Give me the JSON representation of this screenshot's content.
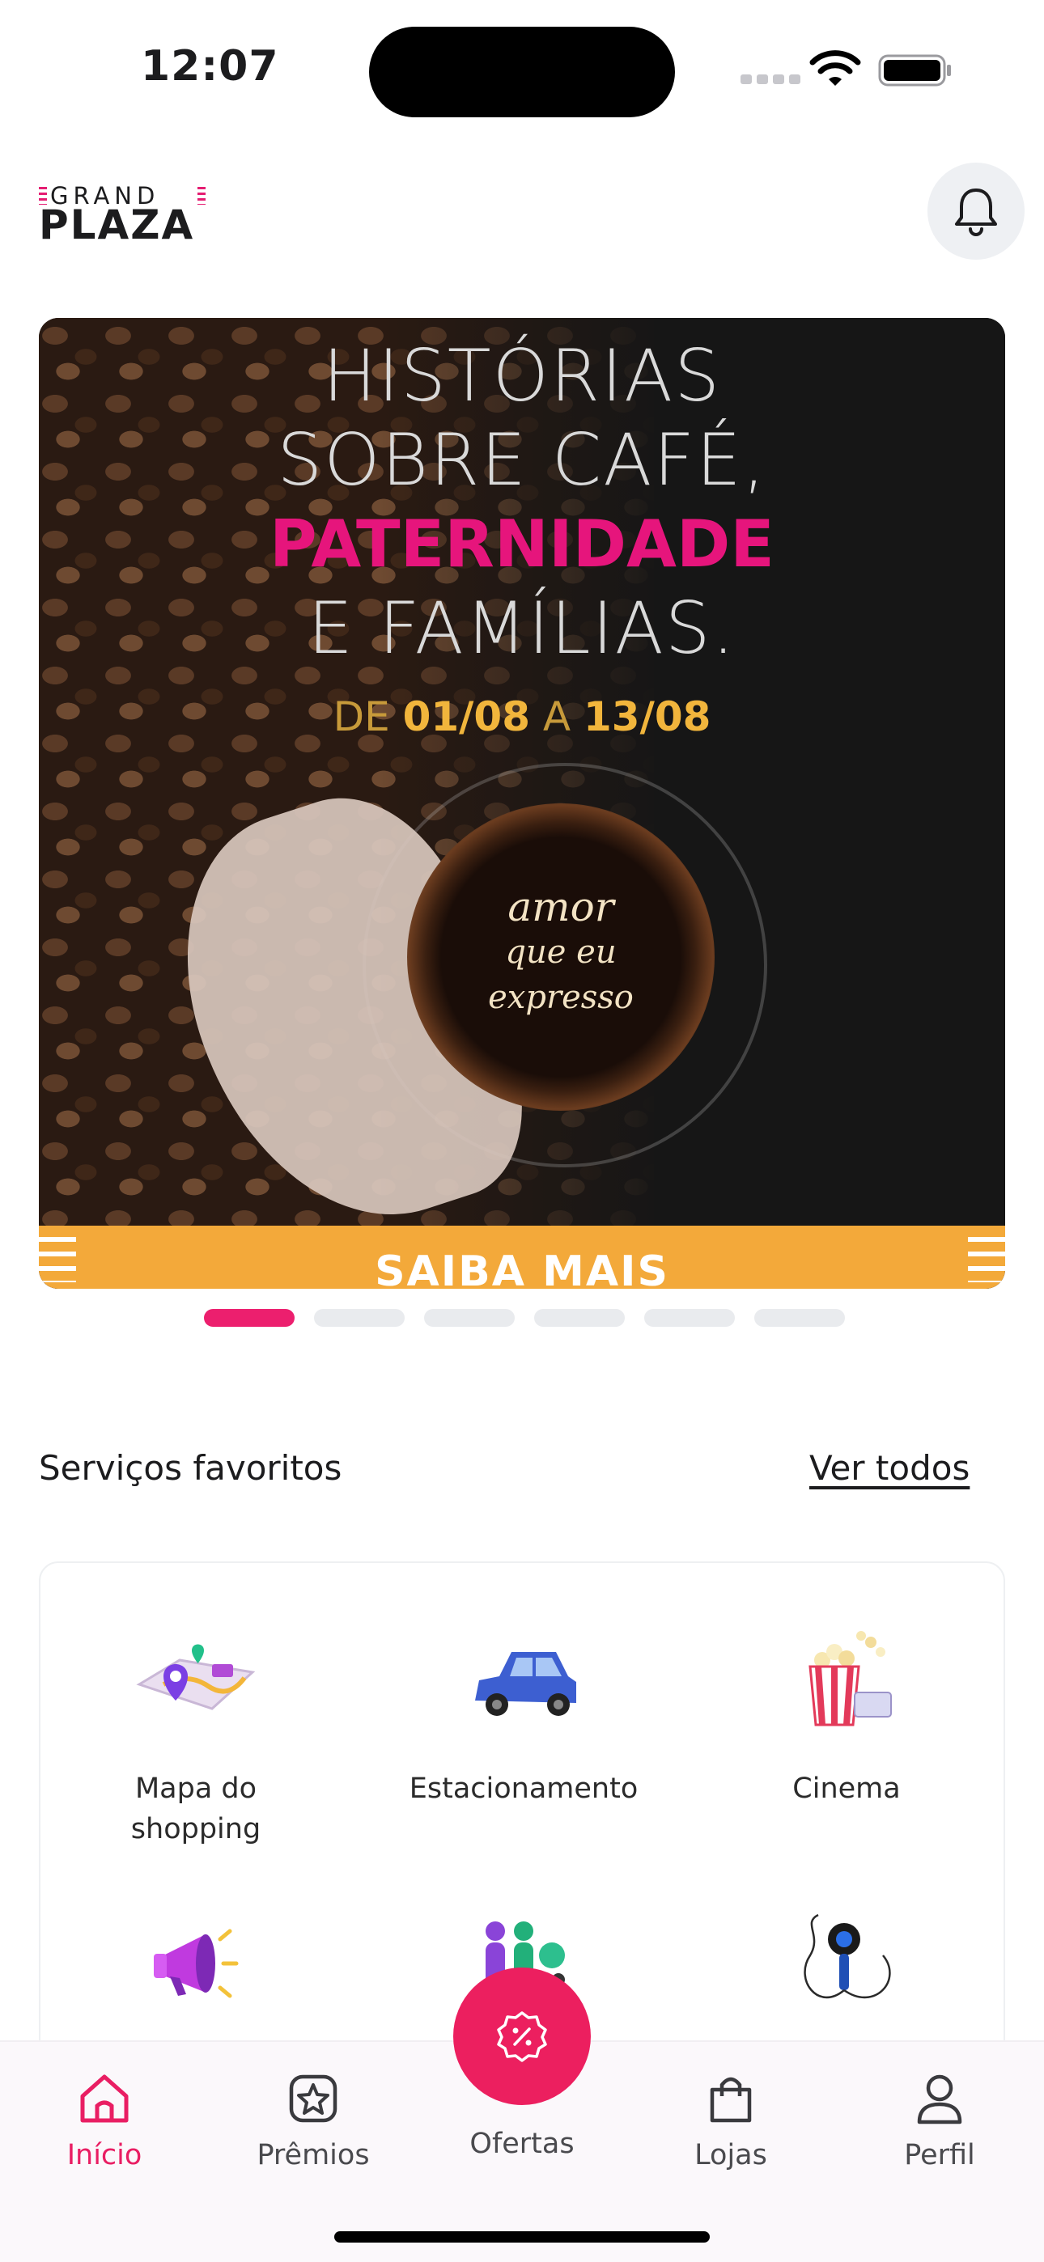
{
  "status_bar": {
    "time": "12:07"
  },
  "header": {
    "logo_top": "GRAND",
    "logo_bottom": "PLAZA"
  },
  "banner": {
    "line1": "HISTÓRIAS",
    "line2": "SOBRE CAFÉ,",
    "line3": "PATERNIDADE",
    "line4": "E FAMÍLIAS.",
    "date_prefix": "DE ",
    "date_start": "01/08",
    "date_mid": " A ",
    "date_end": "13/08",
    "cup_line1": "amor",
    "cup_line2": "que eu",
    "cup_line3": "expresso",
    "cta": "SAIBA MAIS"
  },
  "carousel": {
    "total": 6,
    "active_index": 0
  },
  "favorites": {
    "title": "Serviços favoritos",
    "see_all": "Ver todos",
    "items": [
      {
        "label": "Mapa do shopping",
        "icon": "map-icon"
      },
      {
        "label": "Estacionamento",
        "icon": "car-icon"
      },
      {
        "label": "Cinema",
        "icon": "popcorn-icon"
      },
      {
        "label": "",
        "icon": "megaphone-icon"
      },
      {
        "label": "",
        "icon": "family-icon"
      },
      {
        "label": "",
        "icon": "microphone-icon"
      }
    ]
  },
  "nav": {
    "home": "Início",
    "rewards": "Prêmios",
    "offers": "Ofertas",
    "stores": "Lojas",
    "profile": "Perfil"
  },
  "colors": {
    "accent": "#ec1f6e",
    "banner_cta": "#f3a93a",
    "date": "#f1b53c"
  }
}
